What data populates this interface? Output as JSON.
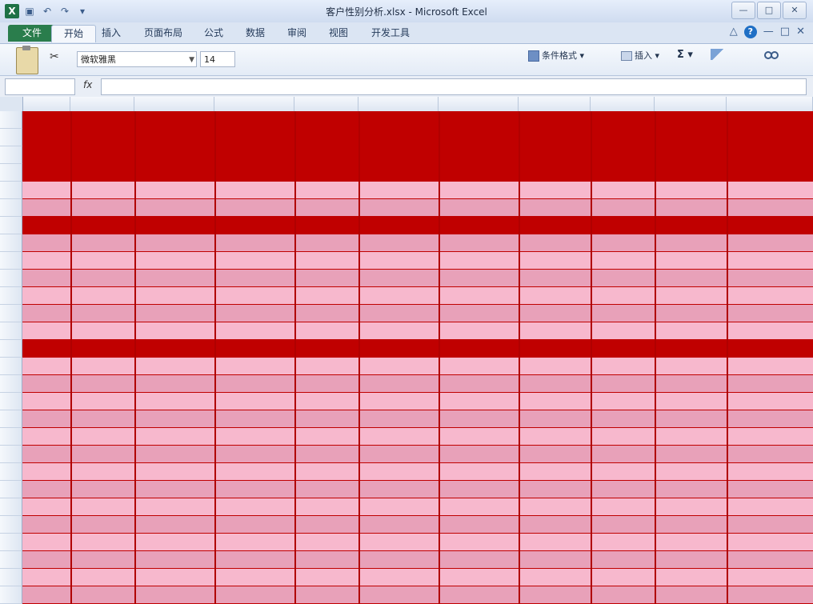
{
  "window": {
    "title": "客户性别分析.xlsx - Microsoft Excel",
    "app_icon": "excel-icon",
    "controls": [
      "minimize-icon",
      "restore-icon",
      "close-icon"
    ]
  },
  "quick_access": {
    "save": "save-icon",
    "undo": "undo-icon",
    "redo": "redo-icon",
    "customize": "customize-qat-icon"
  },
  "tabs": [
    {
      "label": "文件"
    },
    {
      "label": "开始"
    },
    {
      "label": "插入"
    },
    {
      "label": "页面布局"
    },
    {
      "label": "公式"
    },
    {
      "label": "数据"
    },
    {
      "label": "审阅"
    },
    {
      "label": "视图"
    },
    {
      "label": "开发工具"
    }
  ],
  "ribbon": {
    "font_name": "微软雅黑",
    "font_size": "14",
    "conditional_format": "条件格式",
    "insert": "插入",
    "sum_symbol": "Σ"
  },
  "colors": {
    "file_tab": "#2a7d4c",
    "header_band": "#c00000",
    "data_fill": "#f7b8cd"
  }
}
